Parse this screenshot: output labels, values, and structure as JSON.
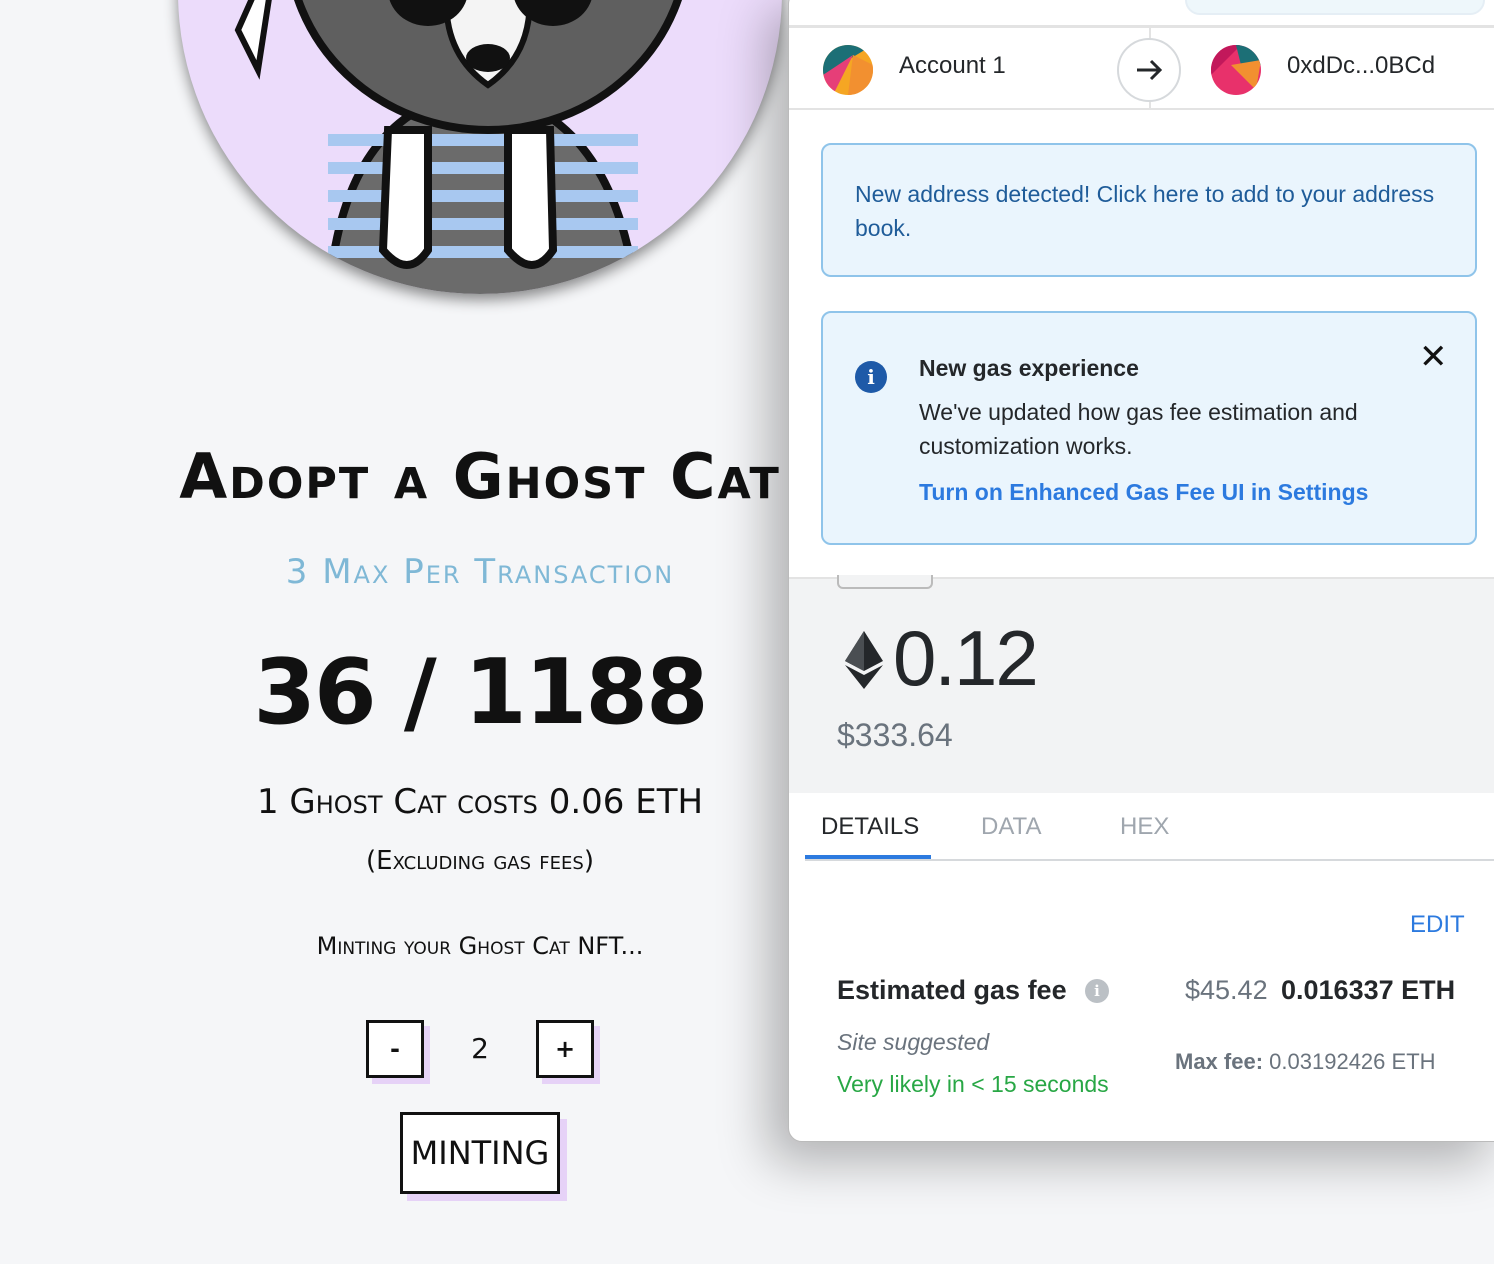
{
  "mint": {
    "title": "Adopt a Ghost Cat",
    "max_per": "3 Max Per Transaction",
    "counter": "36 / 1188",
    "cost": "1 Ghost Cat costs 0.06 ETH",
    "excluding": "(Excluding gas fees)",
    "status": "Minting your Ghost Cat NFT...",
    "qty_minus": "-",
    "qty_value": "2",
    "qty_plus": "+",
    "mint_button": "MINTING"
  },
  "metamask": {
    "from_account": "Account 1",
    "to_address": "0xdDc...0BCd",
    "address_notice": "New address detected! Click here to add to your address book.",
    "gas_notice": {
      "title": "New gas experience",
      "description": "We've updated how gas fee estimation and customization works.",
      "link": "Turn on Enhanced Gas Fee UI in Settings",
      "close": "✕"
    },
    "amount": "0.12",
    "amount_fiat": "$333.64",
    "tabs": [
      "DETAILS",
      "DATA",
      "HEX"
    ],
    "edit": "EDIT",
    "gas_fee_label": "Estimated gas fee",
    "gas_fee_fiat": "$45.42",
    "gas_fee_eth": "0.016337 ETH",
    "site_suggested": "Site suggested",
    "likely": "Very likely in < 15 seconds",
    "max_fee_label": "Max fee:",
    "max_fee_value": "0.03192426 ETH"
  },
  "colors": {
    "accent_blue": "#2c7adf",
    "success_green": "#28a745",
    "notice_bg": "#eaf5fd",
    "avatar_bg": "#ecdcfb"
  }
}
